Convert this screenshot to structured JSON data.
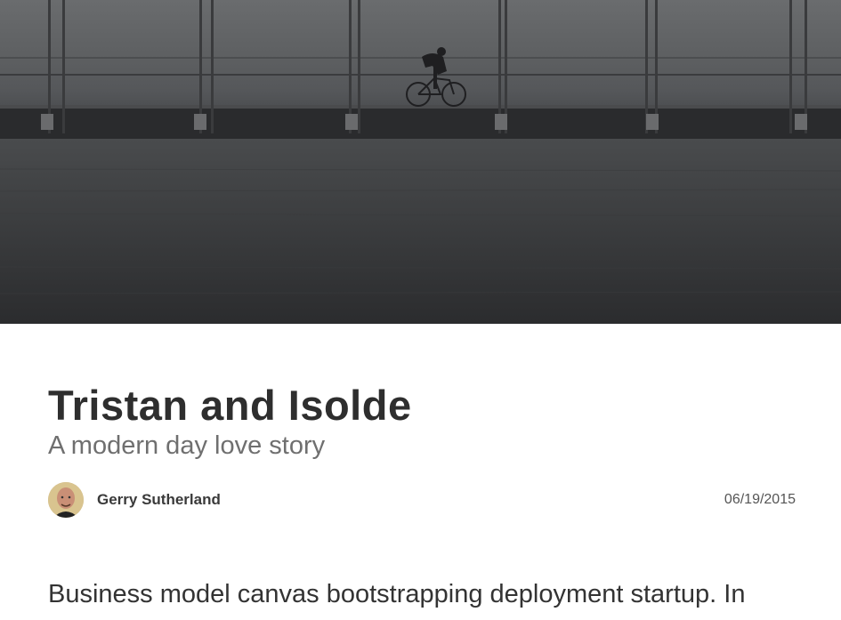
{
  "hero": {
    "image_name": "foggy-bridge-cyclist-photo"
  },
  "article": {
    "title": "Tristan and Isolde",
    "subtitle": "A modern day love story",
    "author_name": "Gerry Sutherland",
    "date": "06/19/2015",
    "body_excerpt": "Business model canvas bootstrapping deployment startup. In"
  }
}
